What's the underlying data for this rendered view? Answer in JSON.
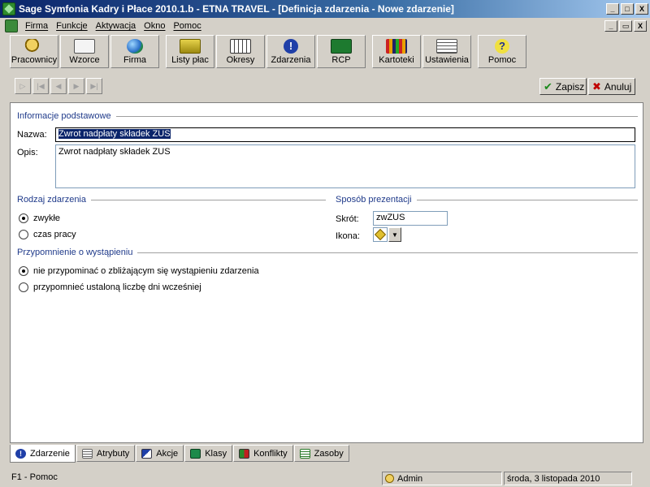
{
  "window": {
    "title": "Sage Symfonia Kadry i Płace 2010.1.b - ETNA TRAVEL - [Definicja zdarzenia - Nowe zdarzenie]",
    "controls": {
      "minimize": "_",
      "maximize": "□",
      "close": "X",
      "restore": "▭"
    }
  },
  "menu": {
    "items": [
      {
        "label": "Firma"
      },
      {
        "label": "Funkcje"
      },
      {
        "label": "Aktywacja"
      },
      {
        "label": "Okno"
      },
      {
        "label": "Pomoc"
      }
    ]
  },
  "toolbar": {
    "buttons": [
      {
        "label": "Pracownicy",
        "icon": "people-icon"
      },
      {
        "label": "Wzorce",
        "icon": "templates-icon"
      },
      {
        "label": "Firma",
        "icon": "globe-icon"
      },
      {
        "label": "Listy płac",
        "icon": "money-icon"
      },
      {
        "label": "Okresy",
        "icon": "calendar-icon"
      },
      {
        "label": "Zdarzenia",
        "icon": "exclamation-icon"
      },
      {
        "label": "RCP",
        "icon": "card-reader-icon"
      },
      {
        "label": "Kartoteki",
        "icon": "binders-icon"
      },
      {
        "label": "Ustawienia",
        "icon": "sliders-icon"
      },
      {
        "label": "Pomoc",
        "icon": "help-icon"
      }
    ]
  },
  "actions": {
    "save": "Zapisz",
    "cancel": "Anuluj"
  },
  "form": {
    "basic_section": "Informacje podstawowe",
    "name_label": "Nazwa:",
    "name_value": "Zwrot nadpłaty składek ZUS",
    "desc_label": "Opis:",
    "desc_value": "Zwrot nadpłaty składek ZUS",
    "type_section": "Rodzaj zdarzenia",
    "type_options": [
      "zwykłe",
      "czas pracy"
    ],
    "type_selected": "zwykłe",
    "presentation_section": "Sposób prezentacji",
    "short_label": "Skrót:",
    "short_value": "zwZUS",
    "icon_label": "Ikona:",
    "reminder_section": "Przypomnienie o wystąpieniu",
    "reminder_options": [
      "nie przypominać o zbliżającym się wystąpieniu zdarzenia",
      "przypomnieć ustaloną liczbę dni wcześniej"
    ],
    "reminder_selected": "nie przypominać o zbliżającym się wystąpieniu zdarzenia"
  },
  "tabs": [
    {
      "label": "Zdarzenie",
      "active": true
    },
    {
      "label": "Atrybuty",
      "active": false
    },
    {
      "label": "Akcje",
      "active": false
    },
    {
      "label": "Klasy",
      "active": false
    },
    {
      "label": "Konflikty",
      "active": false
    },
    {
      "label": "Zasoby",
      "active": false
    }
  ],
  "status": {
    "help": "F1 - Pomoc",
    "user": "Admin",
    "date": "środa, 3 listopada 2010"
  }
}
